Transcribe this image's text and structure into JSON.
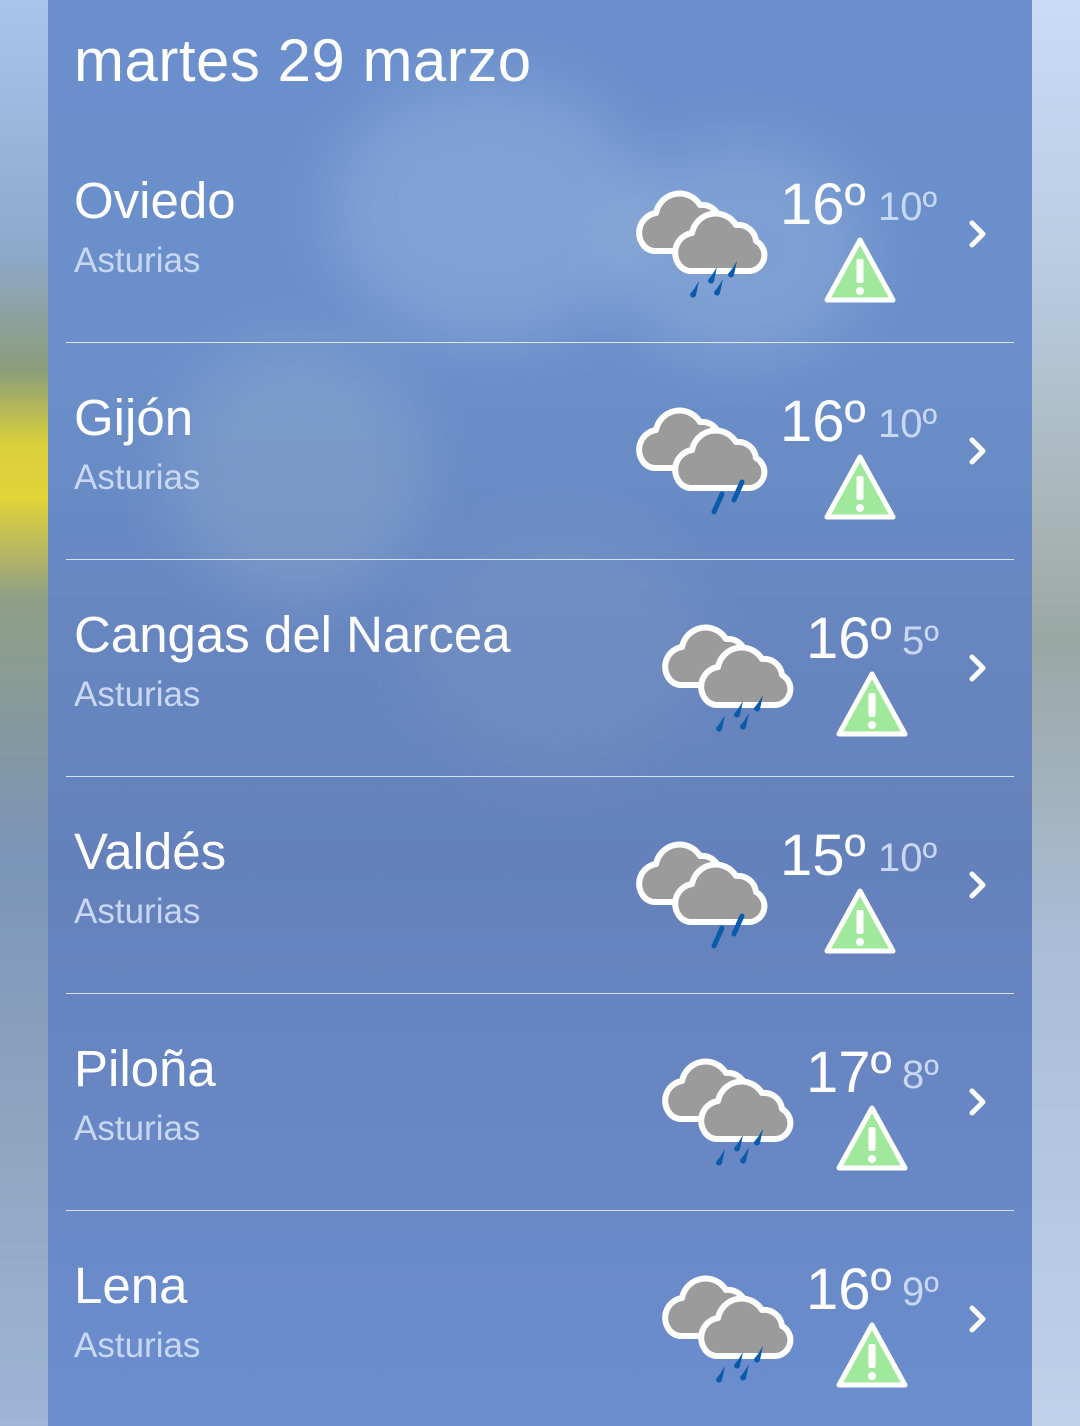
{
  "header": {
    "date": "martes 29 marzo"
  },
  "locations": [
    {
      "city": "Oviedo",
      "region": "Asturias",
      "max": "16º",
      "min": "10º",
      "icon": "rain-cloud-icon",
      "warning": "warning-icon"
    },
    {
      "city": "Gijón",
      "region": "Asturias",
      "max": "16º",
      "min": "10º",
      "icon": "rain-cloud-icon",
      "warning": "warning-icon"
    },
    {
      "city": "Cangas del Narcea",
      "region": "Asturias",
      "max": "16º",
      "min": "5º",
      "icon": "rain-cloud-icon",
      "warning": "warning-icon"
    },
    {
      "city": "Valdés",
      "region": "Asturias",
      "max": "15º",
      "min": "10º",
      "icon": "rain-cloud-icon",
      "warning": "warning-icon"
    },
    {
      "city": "Piloña",
      "region": "Asturias",
      "max": "17º",
      "min": "8º",
      "icon": "rain-cloud-icon",
      "warning": "warning-icon"
    },
    {
      "city": "Lena",
      "region": "Asturias",
      "max": "16º",
      "min": "9º",
      "icon": "rain-cloud-icon",
      "warning": "warning-icon"
    }
  ],
  "colors": {
    "panel": "#6a8fcc",
    "warning_fill": "#9fe89c",
    "rain_drop": "#0a5cab",
    "cloud": "#9b9b9b"
  }
}
